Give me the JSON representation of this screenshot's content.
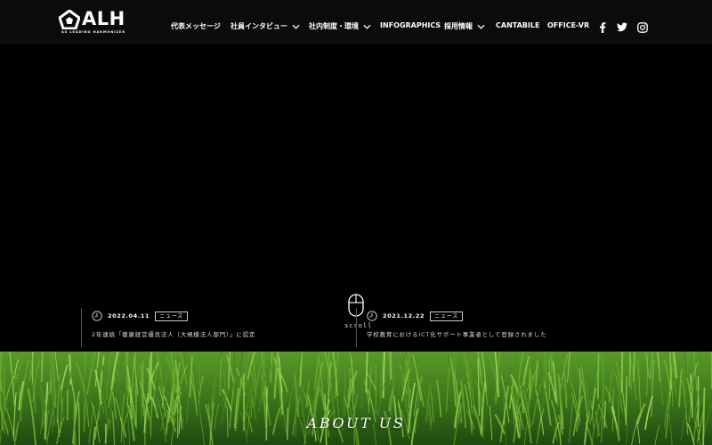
{
  "brand": {
    "name": "ALH",
    "tagline": "AS LEADING HARMONIZER"
  },
  "nav": {
    "items": [
      {
        "label": "代表メッセージ",
        "has_dropdown": false
      },
      {
        "label": "社員インタビュー",
        "has_dropdown": true
      },
      {
        "label": "社内制度・環境",
        "has_dropdown": true
      },
      {
        "label": "INFOGRAPHICS",
        "has_dropdown": false
      },
      {
        "label": "採用情報",
        "has_dropdown": true
      },
      {
        "label": "CANTABILE",
        "has_dropdown": false
      },
      {
        "label": "OFFICE-VR",
        "has_dropdown": false
      }
    ],
    "social": [
      "facebook-icon",
      "twitter-icon",
      "instagram-icon"
    ]
  },
  "hero": {
    "scroll_label": "scroll"
  },
  "news": [
    {
      "date": "2022.04.11",
      "category": "ニュース",
      "title": "2年連続「健康経営優良法人（大規模法人部門）」に認定"
    },
    {
      "date": "2021.12.22",
      "category": "ニュース",
      "title": "学校教育におけるICT化サポート事業者として登録されました"
    }
  ],
  "about": {
    "heading": "ABOUT US"
  },
  "colors": {
    "header_bg": "#0b0b0b",
    "page_bg": "#000000",
    "text": "#ffffff",
    "grass_green": "#4f8a23"
  }
}
